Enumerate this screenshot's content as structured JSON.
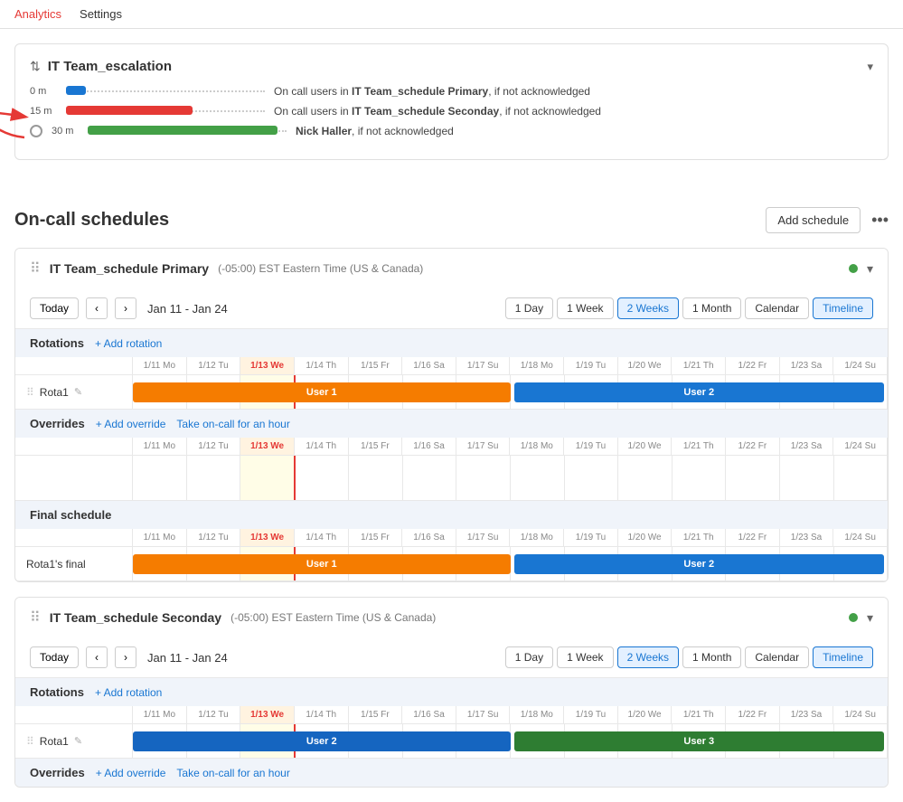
{
  "nav": {
    "items": [
      "Analytics",
      "Settings"
    ]
  },
  "escalation": {
    "title": "IT Team_escalation",
    "chevron": "▾",
    "sort_icon": "⇅",
    "rows": [
      {
        "time": "0 m",
        "bar_type": "blue",
        "desc_prefix": "On call users in ",
        "desc_bold": "IT Team_schedule Primary",
        "desc_suffix": ", if not acknowledged"
      },
      {
        "time": "15 m",
        "bar_type": "red",
        "desc_prefix": "On call users in ",
        "desc_bold": "IT Team_schedule Seconday",
        "desc_suffix": ", if not acknowledged"
      },
      {
        "time": "30 m",
        "bar_type": "green",
        "desc_prefix": "",
        "desc_bold": "Nick Haller",
        "desc_suffix": ", if not acknowledged"
      }
    ]
  },
  "schedules": {
    "title": "On-call schedules",
    "add_button": "Add schedule",
    "more_icon": "•••",
    "cards": [
      {
        "id": "primary",
        "name": "IT Team_schedule Primary",
        "timezone": "(-05:00) EST Eastern Time (US & Canada)",
        "status": "green",
        "date_range": "Jan 11 - Jan 24",
        "views": [
          "1 Day",
          "1 Week",
          "2 Weeks",
          "1 Month",
          "Calendar",
          "Timeline"
        ],
        "active_view": "2 Weeks",
        "timeline_active": true,
        "days": [
          {
            "label": "1/11 Mo",
            "today": false
          },
          {
            "label": "1/12 Tu",
            "today": false
          },
          {
            "label": "1/13 We",
            "today": true
          },
          {
            "label": "1/14 Th",
            "today": false
          },
          {
            "label": "1/15 Fr",
            "today": false
          },
          {
            "label": "1/16 Sa",
            "today": false
          },
          {
            "label": "1/17 Su",
            "today": false
          },
          {
            "label": "1/18 Mo",
            "today": false
          },
          {
            "label": "1/19 Tu",
            "today": false
          },
          {
            "label": "1/20 We",
            "today": false
          },
          {
            "label": "1/21 Th",
            "today": false
          },
          {
            "label": "1/22 Fr",
            "today": false
          },
          {
            "label": "1/23 Sa",
            "today": false
          },
          {
            "label": "1/24 Su",
            "today": false
          }
        ],
        "rotations_label": "Rotations",
        "add_rotation": "+ Add rotation",
        "rota_name": "Rota1",
        "user1_label": "User 1",
        "user2_label": "User 2",
        "overrides_label": "Overrides",
        "add_override": "+ Add override",
        "take_oncall": "Take on-call for an hour",
        "final_label": "Final schedule",
        "final_rota_label": "Rota1's final"
      },
      {
        "id": "seconday",
        "name": "IT Team_schedule Seconday",
        "timezone": "(-05:00) EST Eastern Time (US & Canada)",
        "status": "green",
        "date_range": "Jan 11 - Jan 24",
        "views": [
          "1 Day",
          "1 Week",
          "2 Weeks",
          "1 Month",
          "Calendar",
          "Timeline"
        ],
        "active_view": "2 Weeks",
        "timeline_active": true,
        "days": [
          {
            "label": "1/11 Mo",
            "today": false
          },
          {
            "label": "1/12 Tu",
            "today": false
          },
          {
            "label": "1/13 We",
            "today": true
          },
          {
            "label": "1/14 Th",
            "today": false
          },
          {
            "label": "1/15 Fr",
            "today": false
          },
          {
            "label": "1/16 Sa",
            "today": false
          },
          {
            "label": "1/17 Su",
            "today": false
          },
          {
            "label": "1/18 Mo",
            "today": false
          },
          {
            "label": "1/19 Tu",
            "today": false
          },
          {
            "label": "1/20 We",
            "today": false
          },
          {
            "label": "1/21 Th",
            "today": false
          },
          {
            "label": "1/22 Fr",
            "today": false
          },
          {
            "label": "1/23 Sa",
            "today": false
          },
          {
            "label": "1/24 Su",
            "today": false
          }
        ],
        "rotations_label": "Rotations",
        "add_rotation": "+ Add rotation",
        "rota_name": "Rota1",
        "user1_label": "User 2",
        "user2_label": "User 3",
        "overrides_label": "Overrides",
        "add_override": "+ Add override",
        "take_oncall": "Take on-call for an hour"
      }
    ]
  }
}
